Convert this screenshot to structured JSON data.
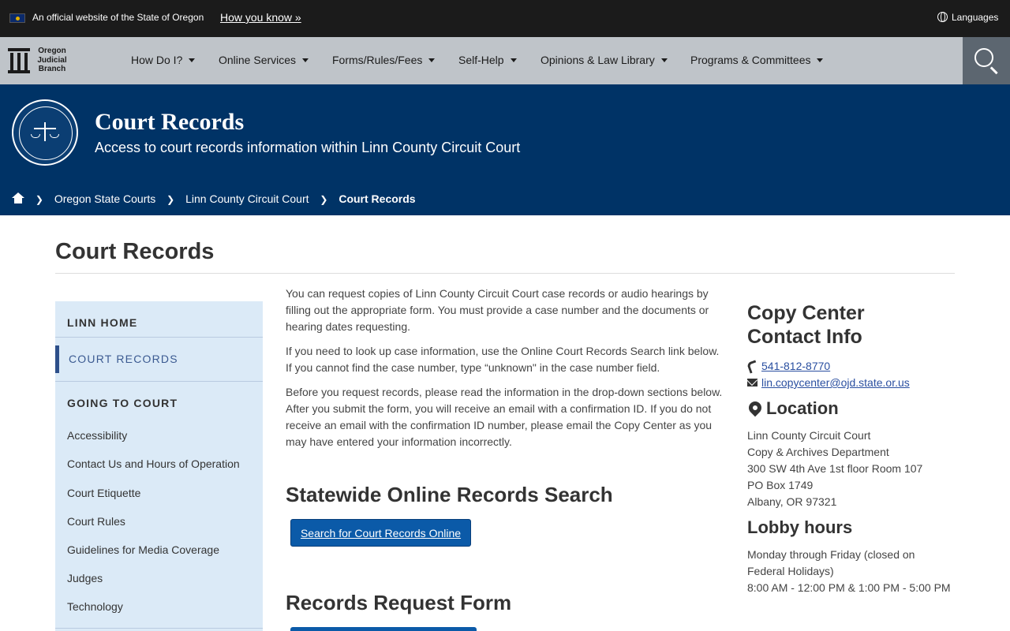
{
  "banner": {
    "official_text": "An official website of the State of Oregon",
    "how_you_know": "How you know »",
    "languages": "Languages"
  },
  "nav": {
    "logo_lines": [
      "Oregon",
      "Judicial",
      "Branch"
    ],
    "items": [
      {
        "label": "How Do I?"
      },
      {
        "label": "Online Services"
      },
      {
        "label": "Forms/Rules/Fees"
      },
      {
        "label": "Self-Help"
      },
      {
        "label": "Opinions & Law Library"
      },
      {
        "label": "Programs & Committees"
      }
    ],
    "search_icon": "search-icon"
  },
  "hero": {
    "title": "Court Records",
    "subtitle": "Access to court records information within Linn County Circuit Court",
    "breadcrumb": [
      "Oregon State Courts",
      "Linn County Circuit Court",
      "Court Records"
    ]
  },
  "page": {
    "title": "Court Records"
  },
  "sidebar": {
    "home": "LINN HOME",
    "active": "COURT RECORDS",
    "section": "GOING TO COURT",
    "links": [
      "Accessibility",
      "Contact Us and Hours of Operation",
      "Court Etiquette",
      "Court Rules",
      "Guidelines for Media Coverage",
      "Judges",
      "Technology"
    ]
  },
  "main": {
    "paragraphs": [
      "You can request copies of Linn County Circuit Court case records or audio hearings by filling out the appropriate form. You must provide a case number and the documents or hearing dates requesting.",
      "If you need to look up case information, use the Online Court Records Search link below. If you cannot find the case number, type “unknown\" in the case number field.",
      "Before you request records, please read the information in the drop-down sections below. After you submit the form, you will receive an email with a confirmation ID. If you do not receive an email with the confirmation ID number, please email the Copy Center as you may have entered your information incorrectly."
    ],
    "search_heading": "Statewide Online Records Search",
    "search_button": "Search for Court Records Online",
    "form_heading": "Records Request Form"
  },
  "right": {
    "contact_heading": "Copy Center Contact Info",
    "phone": "541-812-8770",
    "email": "lin.copycenter@ojd.state.or.us",
    "location_heading": "Location",
    "address": [
      "Linn County Circuit Court",
      "Copy & Archives Department",
      "300 SW 4th Ave 1st floor Room 107",
      "PO Box 1749",
      "Albany, OR 97321"
    ],
    "lobby_heading": "Lobby hours",
    "lobby_lines": [
      "Monday through Friday (closed on",
      "Federal Holidays)",
      "8:00 AM - 12:00 PM & 1:00 PM - 5:00 PM"
    ]
  }
}
